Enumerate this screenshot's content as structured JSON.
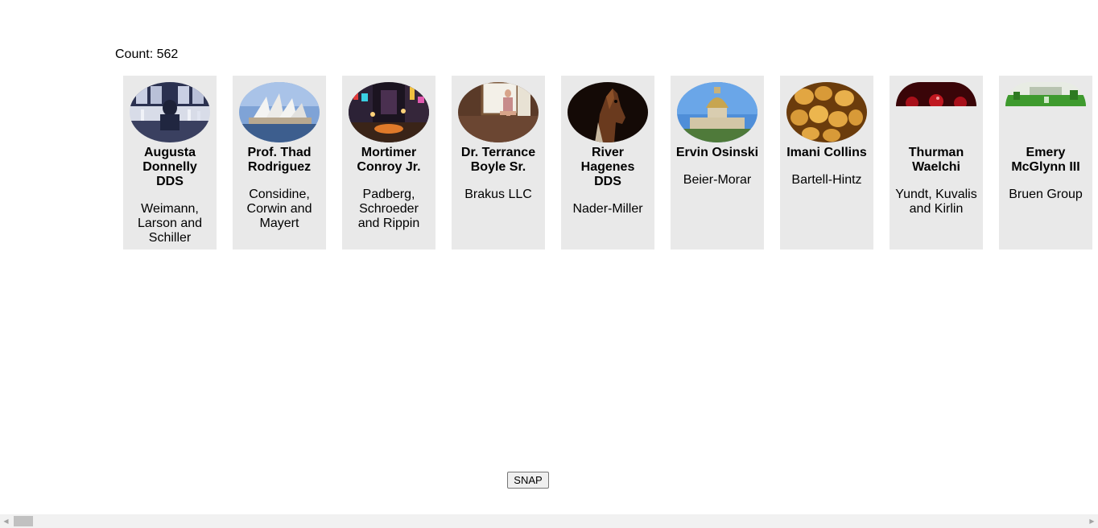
{
  "count_label": "Count: 562",
  "snap_button": "SNAP",
  "cards": [
    {
      "name": "Augusta Donnelly DDS",
      "company": "Weimann, Larson and Schiller",
      "image": "bartender-photo"
    },
    {
      "name": "Prof. Thad Rodriguez",
      "company": "Considine, Corwin and Mayert",
      "image": "sydney-opera-house-photo"
    },
    {
      "name": "Mortimer Conroy Jr.",
      "company": "Padberg, Schroeder and Rippin",
      "image": "night-city-street-photo"
    },
    {
      "name": "Dr. Terrance Boyle Sr.",
      "company": "Brakus LLC",
      "image": "woman-in-window-photo"
    },
    {
      "name": "River Hagenes DDS",
      "company": "Nader-Miller",
      "image": "horse-photo"
    },
    {
      "name": "Ervin Osinski",
      "company": "Beier-Morar",
      "image": "domed-building-photo"
    },
    {
      "name": "Imani Collins",
      "company": "Bartell-Hintz",
      "image": "potatoes-photo"
    },
    {
      "name": "Thurman Waelchi",
      "company": "Yundt, Kuvalis and Kirlin",
      "image": "red-fruit-photo"
    },
    {
      "name": "Emery McGlynn III",
      "company": "Bruen Group",
      "image": "garden-photo"
    }
  ]
}
